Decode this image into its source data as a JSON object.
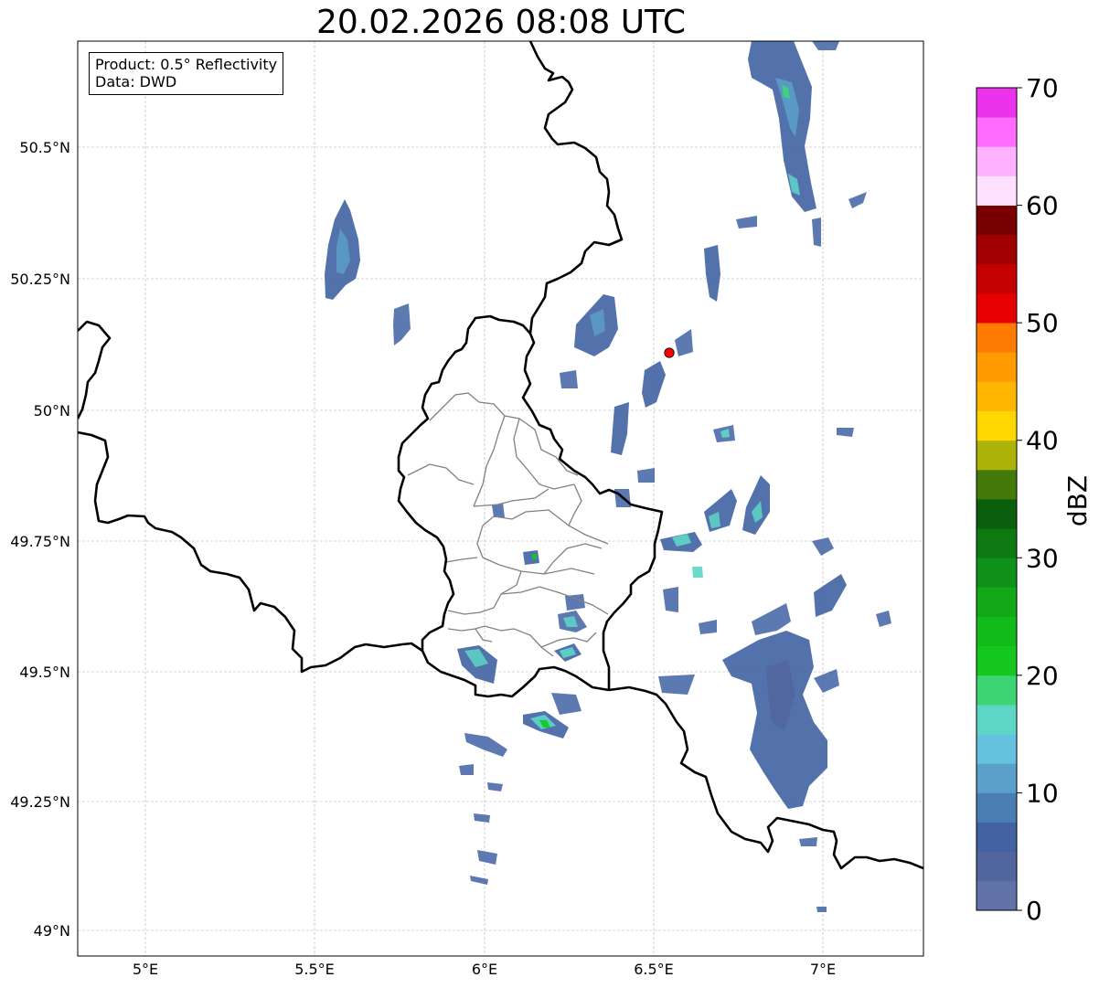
{
  "title": "20.02.2026 08:08 UTC",
  "info": {
    "product": "Product: 0.5° Reflectivity",
    "data": "Data: DWD"
  },
  "axes": {
    "lon_ticks": [
      "5°E",
      "5.5°E",
      "6°E",
      "6.5°E",
      "7°E"
    ],
    "lat_ticks": [
      "50.5°N",
      "50.25°N",
      "50°N",
      "49.75°N",
      "49.5°N",
      "49.25°N",
      "49°N"
    ]
  },
  "colorbar": {
    "unit": "dBZ",
    "tick_labels": [
      "0",
      "10",
      "20",
      "30",
      "40",
      "50",
      "60",
      "70"
    ],
    "colors": [
      "#6172a6",
      "#52669e",
      "#4262a2",
      "#4a7db2",
      "#5b9fcb",
      "#65c2de",
      "#5ed6c6",
      "#3dd574",
      "#15c81f",
      "#12ba1a",
      "#12a816",
      "#10921a",
      "#0c7a10",
      "#0a5e0c",
      "#437a0a",
      "#aeb30a",
      "#ffd700",
      "#ffb600",
      "#ff9a00",
      "#ff7a00",
      "#e60000",
      "#c40000",
      "#a00000",
      "#780000",
      "#ffe0ff",
      "#ffb2ff",
      "#ff6cff",
      "#ea33ea"
    ]
  },
  "radar_site": {
    "label": "",
    "color": "#ff0000"
  },
  "chart_data": {
    "type": "map",
    "xlim": [
      4.8,
      7.3
    ],
    "ylim": [
      48.95,
      50.7
    ],
    "x_ticks": [
      5.0,
      5.5,
      6.0,
      6.5,
      7.0
    ],
    "y_ticks": [
      50.5,
      50.25,
      50.0,
      49.75,
      49.5,
      49.25,
      49.0
    ],
    "grid": true,
    "radar_site_lon": 6.55,
    "radar_site_lat": 50.11
  }
}
